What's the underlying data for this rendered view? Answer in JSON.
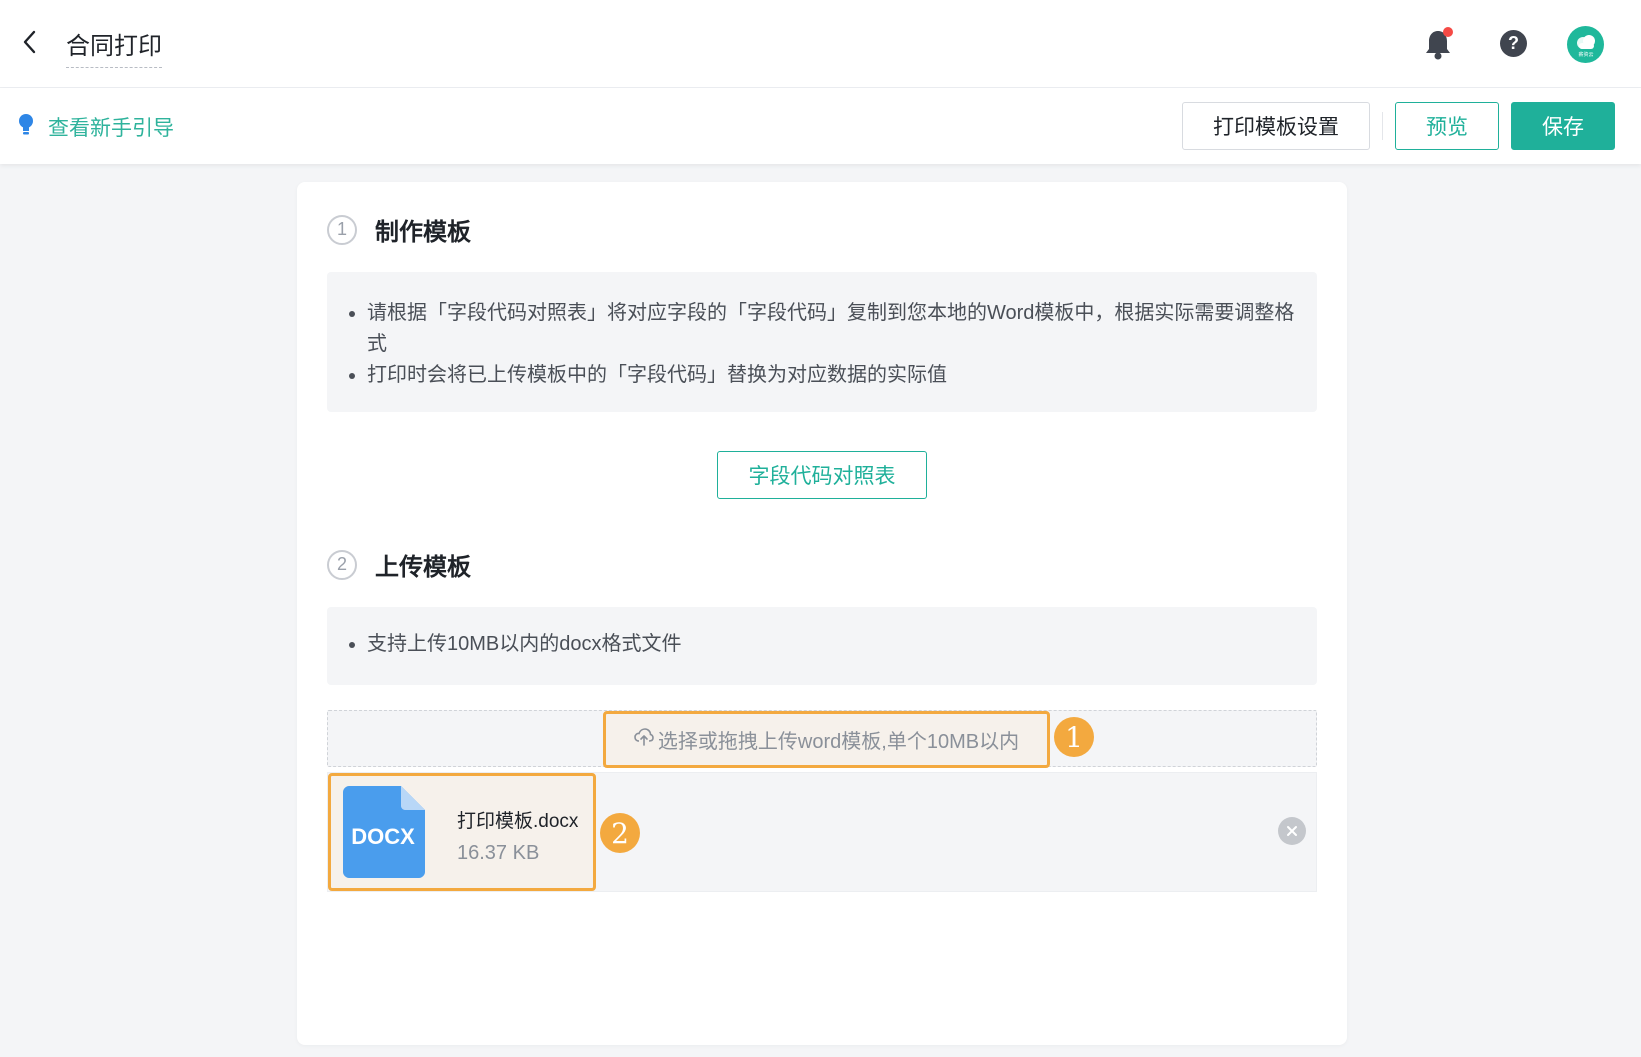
{
  "header": {
    "title": "合同打印",
    "help_glyph": "?",
    "avatar_text": "薪资云"
  },
  "toolbar": {
    "guide_label": "查看新手引导",
    "settings_label": "打印模板设置",
    "preview_label": "预览",
    "save_label": "保存"
  },
  "steps": [
    {
      "number": "1",
      "title": "制作模板",
      "tips": [
        "请根据「字段代码对照表」将对应字段的「字段代码」复制到您本地的Word模板中，根据实际需要调整格式",
        "打印时会将已上传模板中的「字段代码」替换为对应数据的实际值"
      ],
      "button_label": "字段代码对照表"
    },
    {
      "number": "2",
      "title": "上传模板",
      "tips": [
        "支持上传10MB以内的docx格式文件"
      ]
    }
  ],
  "upload": {
    "dropzone_text": "选择或拖拽上传word模板,单个10MB以内",
    "annotation_1": "1",
    "annotation_2": "2",
    "file": {
      "icon_label": "DOCX",
      "name": "打印模板.docx",
      "size": "16.37 KB"
    }
  },
  "colors": {
    "accent": "#1fb09a",
    "highlight": "#f3a93f",
    "notification_dot": "#f54a45"
  }
}
